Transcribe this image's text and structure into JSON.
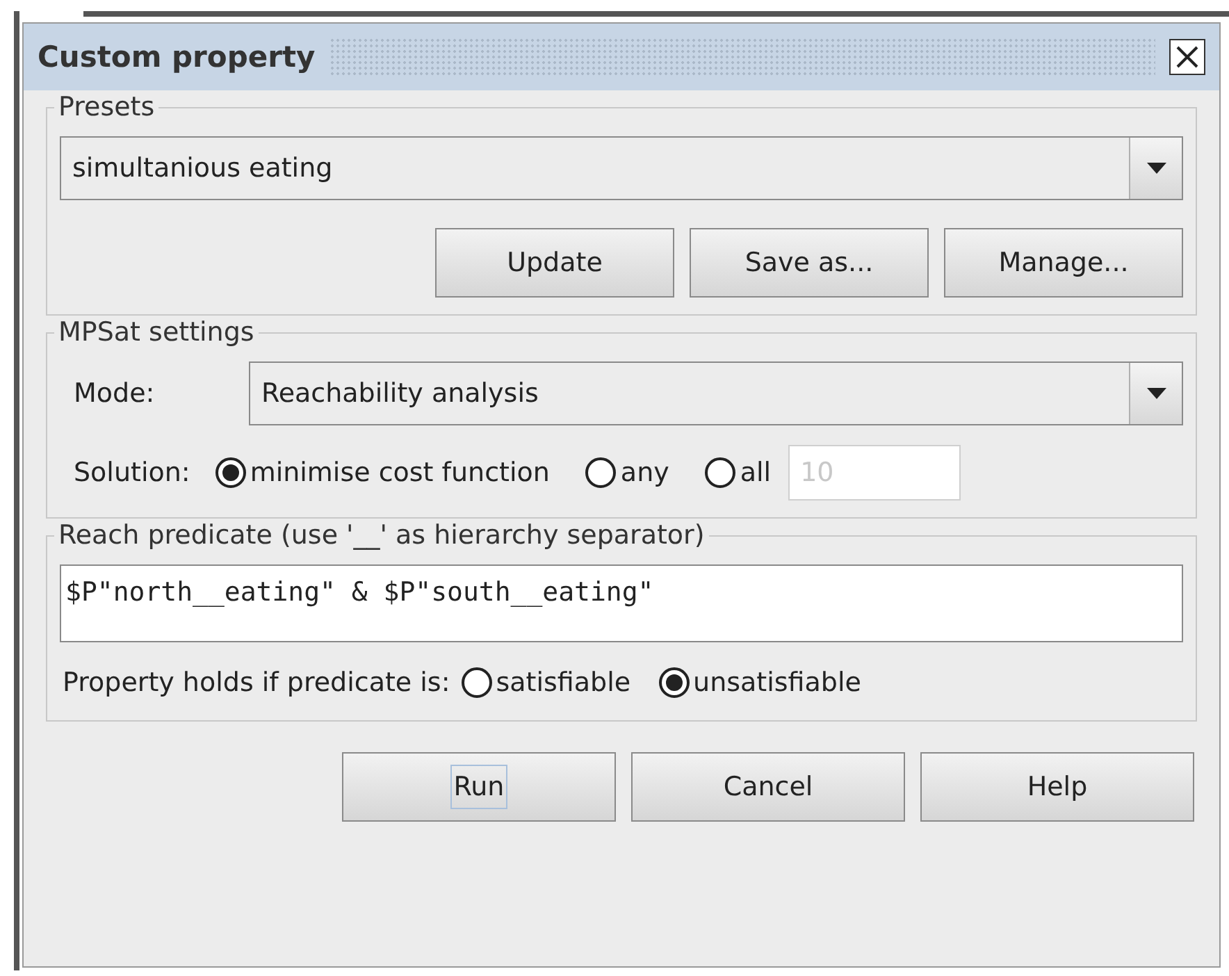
{
  "window": {
    "title": "Custom property"
  },
  "presets": {
    "legend": "Presets",
    "value": "simultanious eating",
    "buttons": [
      "Update",
      "Save as...",
      "Manage..."
    ]
  },
  "mpsat": {
    "legend": "MPSat settings",
    "mode_label": "Mode:",
    "mode_value": "Reachability analysis",
    "solution_label": "Solution:",
    "solution_options": [
      {
        "label": "minimise cost function",
        "selected": true
      },
      {
        "label": "any",
        "selected": false
      },
      {
        "label": "all",
        "selected": false
      }
    ],
    "solution_limit_placeholder": "10"
  },
  "reach": {
    "legend": "Reach predicate (use '__' as hierarchy separator)",
    "predicate": "$P\"north__eating\" & $P\"south__eating\"",
    "holds_label": "Property holds if predicate is:",
    "holds_options": [
      {
        "label": "satisfiable",
        "selected": false
      },
      {
        "label": "unsatisfiable",
        "selected": true
      }
    ]
  },
  "buttons": [
    {
      "label": "Run",
      "focused": true
    },
    {
      "label": "Cancel",
      "focused": false
    },
    {
      "label": "Help",
      "focused": false
    }
  ]
}
